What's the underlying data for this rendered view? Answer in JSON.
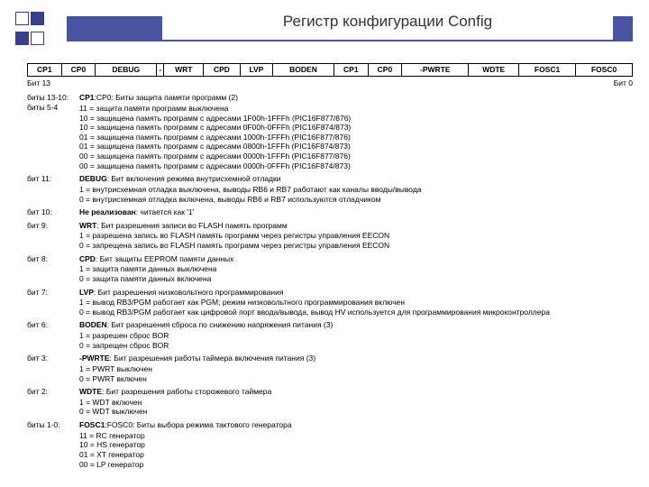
{
  "title": "Регистр конфигурации Config",
  "regbits": [
    "CP1",
    "CP0",
    "DEBUG",
    "-",
    "WRT",
    "CPD",
    "LVP",
    "BODEN",
    "CP1",
    "CP0",
    "-PWRTE",
    "WDTE",
    "FOSC1",
    "FOSC0"
  ],
  "bitleft": "Бит 13",
  "bitright": "Бит 0",
  "entries": [
    {
      "lab": "биты 13-10:\nбиты 5-4",
      "head": "CP1:CP0: Биты защита памяти программ (2)",
      "lines": [
        "11 = защита памяти программ выключена",
        "10 = защищена память программ с адресами 1F00h-1FFFh (PIC16F877/876)",
        "10 = защищена память программ с адресами 0F00h-0FFFh (PIC16F874/873)",
        "01 = защищена память программ с адресами 1000h-1FFFh (PIC16F877/876)",
        "01 = защищена память программ с адресами 0800h-1FFFh (PIC16F874/873)",
        "00 = защищена память программ с адресами 0000h-1FFFh (PIC16F877/876)",
        "00 = защищена память программ с адресами 0000h-0FFFh (PIC16F874/873)"
      ]
    },
    {
      "lab": "бит 11:",
      "head": "DEBUG: Бит включения режима внутрисхемной отладки",
      "lines": [
        "1 = внутрисхемная отладка выключена, выводы RB6 и RB7 работают как каналы вводы/вывода",
        "0 = внутрисхемная отладка включена, выводы RB6 и RB7 используются отладчиком"
      ]
    },
    {
      "lab": "бит 10:",
      "head": "Не реализован: читается как '1'",
      "lines": []
    },
    {
      "lab": "бит 9:",
      "head": "WRT: Бит разрешения записи во FLASH память программ",
      "lines": [
        "1 = разрешена запись во FLASH память программ через регистры управления EECON",
        "0 = запрещена запись во FLASH память программ через регистры управления EECON"
      ]
    },
    {
      "lab": "бит 8:",
      "head": "CPD: Бит защиты EEPROM памяти данных",
      "lines": [
        "1 = защита памяти данных выключена",
        "0 = защита памяти данных включена"
      ]
    },
    {
      "lab": "бит 7:",
      "head": "LVP: Бит разрешения низковольтного программирования",
      "lines": [
        "1 = вывод RB3/PGM работает как PGM; режим низковольтного программирования включен",
        "0 = вывод RB3/PGM работает как цифровой порт ввода/вывода, вывод HV используется для программирования микроконтроллера"
      ]
    },
    {
      "lab": "бит 6:",
      "head": "BODEN: Бит разрешения сброса по снижению напряжения питания (3)",
      "lines": [
        "1 = разрешен сброс BOR",
        "0 = запрещен сброс BOR"
      ]
    },
    {
      "lab": "бит 3:",
      "head": "-PWRTE: Бит разрешения работы таймера включения питания (3)",
      "lines": [
        "1 = PWRT выключен",
        "0 = PWRT включен"
      ]
    },
    {
      "lab": "бит 2:",
      "head": "WDTE: Бит разрешения работы сторожевого таймера",
      "lines": [
        "1 = WDT включен",
        "0 = WDT выключен"
      ]
    },
    {
      "lab": "биты 1-0:",
      "head": "FOSC1:FOSC0: Биты выбора режима тактового генератора",
      "lines": [
        "11 = RC генератор",
        "10 = HS генератор",
        "01 = XT генератор",
        "00 = LP генератор"
      ]
    }
  ]
}
